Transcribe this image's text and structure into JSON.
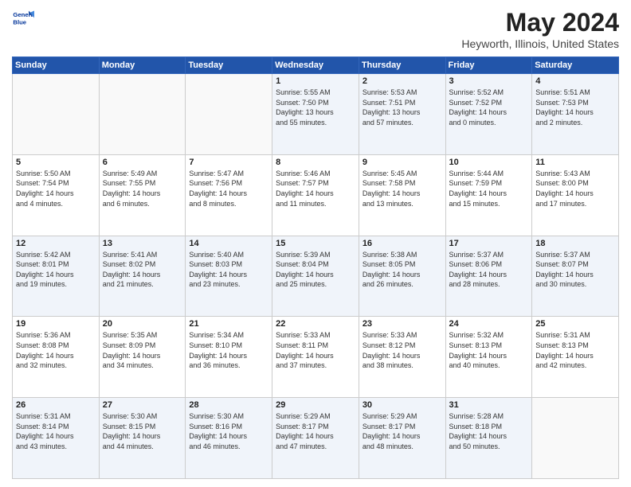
{
  "logo": {
    "line1": "General",
    "line2": "Blue"
  },
  "title": "May 2024",
  "subtitle": "Heyworth, Illinois, United States",
  "days_of_week": [
    "Sunday",
    "Monday",
    "Tuesday",
    "Wednesday",
    "Thursday",
    "Friday",
    "Saturday"
  ],
  "weeks": [
    [
      {
        "day": "",
        "info": ""
      },
      {
        "day": "",
        "info": ""
      },
      {
        "day": "",
        "info": ""
      },
      {
        "day": "1",
        "info": "Sunrise: 5:55 AM\nSunset: 7:50 PM\nDaylight: 13 hours\nand 55 minutes."
      },
      {
        "day": "2",
        "info": "Sunrise: 5:53 AM\nSunset: 7:51 PM\nDaylight: 13 hours\nand 57 minutes."
      },
      {
        "day": "3",
        "info": "Sunrise: 5:52 AM\nSunset: 7:52 PM\nDaylight: 14 hours\nand 0 minutes."
      },
      {
        "day": "4",
        "info": "Sunrise: 5:51 AM\nSunset: 7:53 PM\nDaylight: 14 hours\nand 2 minutes."
      }
    ],
    [
      {
        "day": "5",
        "info": "Sunrise: 5:50 AM\nSunset: 7:54 PM\nDaylight: 14 hours\nand 4 minutes."
      },
      {
        "day": "6",
        "info": "Sunrise: 5:49 AM\nSunset: 7:55 PM\nDaylight: 14 hours\nand 6 minutes."
      },
      {
        "day": "7",
        "info": "Sunrise: 5:47 AM\nSunset: 7:56 PM\nDaylight: 14 hours\nand 8 minutes."
      },
      {
        "day": "8",
        "info": "Sunrise: 5:46 AM\nSunset: 7:57 PM\nDaylight: 14 hours\nand 11 minutes."
      },
      {
        "day": "9",
        "info": "Sunrise: 5:45 AM\nSunset: 7:58 PM\nDaylight: 14 hours\nand 13 minutes."
      },
      {
        "day": "10",
        "info": "Sunrise: 5:44 AM\nSunset: 7:59 PM\nDaylight: 14 hours\nand 15 minutes."
      },
      {
        "day": "11",
        "info": "Sunrise: 5:43 AM\nSunset: 8:00 PM\nDaylight: 14 hours\nand 17 minutes."
      }
    ],
    [
      {
        "day": "12",
        "info": "Sunrise: 5:42 AM\nSunset: 8:01 PM\nDaylight: 14 hours\nand 19 minutes."
      },
      {
        "day": "13",
        "info": "Sunrise: 5:41 AM\nSunset: 8:02 PM\nDaylight: 14 hours\nand 21 minutes."
      },
      {
        "day": "14",
        "info": "Sunrise: 5:40 AM\nSunset: 8:03 PM\nDaylight: 14 hours\nand 23 minutes."
      },
      {
        "day": "15",
        "info": "Sunrise: 5:39 AM\nSunset: 8:04 PM\nDaylight: 14 hours\nand 25 minutes."
      },
      {
        "day": "16",
        "info": "Sunrise: 5:38 AM\nSunset: 8:05 PM\nDaylight: 14 hours\nand 26 minutes."
      },
      {
        "day": "17",
        "info": "Sunrise: 5:37 AM\nSunset: 8:06 PM\nDaylight: 14 hours\nand 28 minutes."
      },
      {
        "day": "18",
        "info": "Sunrise: 5:37 AM\nSunset: 8:07 PM\nDaylight: 14 hours\nand 30 minutes."
      }
    ],
    [
      {
        "day": "19",
        "info": "Sunrise: 5:36 AM\nSunset: 8:08 PM\nDaylight: 14 hours\nand 32 minutes."
      },
      {
        "day": "20",
        "info": "Sunrise: 5:35 AM\nSunset: 8:09 PM\nDaylight: 14 hours\nand 34 minutes."
      },
      {
        "day": "21",
        "info": "Sunrise: 5:34 AM\nSunset: 8:10 PM\nDaylight: 14 hours\nand 36 minutes."
      },
      {
        "day": "22",
        "info": "Sunrise: 5:33 AM\nSunset: 8:11 PM\nDaylight: 14 hours\nand 37 minutes."
      },
      {
        "day": "23",
        "info": "Sunrise: 5:33 AM\nSunset: 8:12 PM\nDaylight: 14 hours\nand 38 minutes."
      },
      {
        "day": "24",
        "info": "Sunrise: 5:32 AM\nSunset: 8:13 PM\nDaylight: 14 hours\nand 40 minutes."
      },
      {
        "day": "25",
        "info": "Sunrise: 5:31 AM\nSunset: 8:13 PM\nDaylight: 14 hours\nand 42 minutes."
      }
    ],
    [
      {
        "day": "26",
        "info": "Sunrise: 5:31 AM\nSunset: 8:14 PM\nDaylight: 14 hours\nand 43 minutes."
      },
      {
        "day": "27",
        "info": "Sunrise: 5:30 AM\nSunset: 8:15 PM\nDaylight: 14 hours\nand 44 minutes."
      },
      {
        "day": "28",
        "info": "Sunrise: 5:30 AM\nSunset: 8:16 PM\nDaylight: 14 hours\nand 46 minutes."
      },
      {
        "day": "29",
        "info": "Sunrise: 5:29 AM\nSunset: 8:17 PM\nDaylight: 14 hours\nand 47 minutes."
      },
      {
        "day": "30",
        "info": "Sunrise: 5:29 AM\nSunset: 8:17 PM\nDaylight: 14 hours\nand 48 minutes."
      },
      {
        "day": "31",
        "info": "Sunrise: 5:28 AM\nSunset: 8:18 PM\nDaylight: 14 hours\nand 50 minutes."
      },
      {
        "day": "",
        "info": ""
      }
    ]
  ]
}
